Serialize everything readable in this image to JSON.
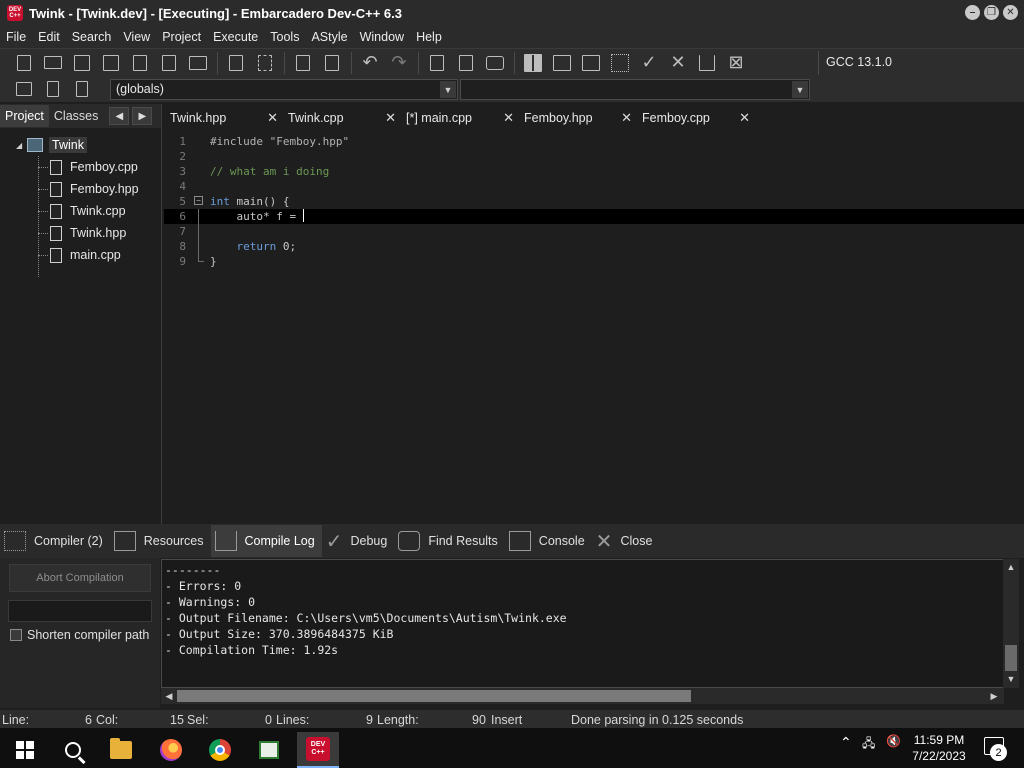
{
  "window": {
    "title": "Twink - [Twink.dev] - [Executing] - Embarcadero Dev-C++ 6.3",
    "app_badge": "DEV C++"
  },
  "menu": [
    "File",
    "Edit",
    "Search",
    "View",
    "Project",
    "Execute",
    "Tools",
    "AStyle",
    "Window",
    "Help"
  ],
  "toolbar": {
    "compiler": "GCC 13.1.0",
    "scope_combo": "(globals)"
  },
  "left_panel": {
    "tabs": [
      "Project",
      "Classes"
    ],
    "project_name": "Twink",
    "files": [
      "Femboy.cpp",
      "Femboy.hpp",
      "Twink.cpp",
      "Twink.hpp",
      "main.cpp"
    ]
  },
  "editor": {
    "tabs": [
      "Twink.hpp",
      "Twink.cpp",
      "[*] main.cpp",
      "Femboy.hpp",
      "Femboy.cpp"
    ],
    "active_tab": 2,
    "lines": [
      {
        "n": "1",
        "text": "#include \"Femboy.hpp\""
      },
      {
        "n": "2",
        "text": ""
      },
      {
        "n": "3",
        "text": "// what am i doing"
      },
      {
        "n": "4",
        "text": ""
      },
      {
        "n": "5",
        "kw": "int",
        "text": " main() {"
      },
      {
        "n": "6",
        "text": "    auto* f = "
      },
      {
        "n": "7",
        "text": ""
      },
      {
        "n": "8",
        "kw": "    return",
        "text": " 0;"
      },
      {
        "n": "9",
        "text": "}"
      }
    ]
  },
  "bottom_tabs": [
    "Compiler (2)",
    "Resources",
    "Compile Log",
    "Debug",
    "Find Results",
    "Console",
    "Close"
  ],
  "compile": {
    "abort_label": "Abort Compilation",
    "shorten_label": "Shorten compiler path",
    "log": [
      "--------",
      "- Errors: 0",
      "- Warnings: 0",
      "- Output Filename: C:\\Users\\vm5\\Documents\\Autism\\Twink.exe",
      "- Output Size: 370.3896484375 KiB",
      "- Compilation Time: 1.92s"
    ]
  },
  "status": {
    "line_label": "Line:",
    "line_val": "6",
    "col_label": "Col:",
    "col_val": "15",
    "sel_label": "Sel:",
    "sel_val": "0",
    "lines_label": "Lines:",
    "lines_val": "9",
    "length_label": "Length:",
    "length_val": "90",
    "mode": "Insert",
    "message": "Done parsing in 0.125 seconds"
  },
  "taskbar": {
    "time": "11:59 PM",
    "date": "7/22/2023",
    "notifications": "2",
    "dev_badge": "DEV C++"
  }
}
